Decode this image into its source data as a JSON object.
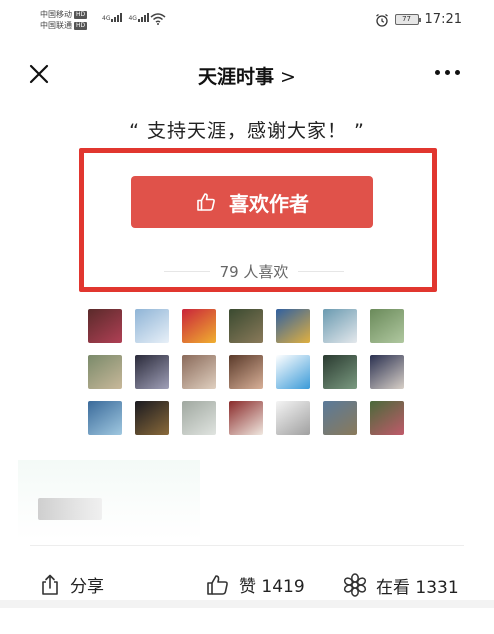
{
  "status_bar": {
    "carrier1": "中国移动",
    "carrier2": "中国联通",
    "hd_label": "HD",
    "network_label_1": "4G",
    "network_label_2": "4G",
    "battery": "77",
    "time": "17:21"
  },
  "nav": {
    "title": "天涯时事"
  },
  "article": {
    "support_text": "“ 支持天涯，感谢大家！ ”",
    "like_author_label": "喜欢作者",
    "like_count_text": "79 人喜欢"
  },
  "avatars": [
    {
      "name": "avatar-1",
      "colors": [
        "#5a2a2a",
        "#b04055"
      ]
    },
    {
      "name": "avatar-2",
      "colors": [
        "#8fb4d6",
        "#e8f0f8"
      ]
    },
    {
      "name": "avatar-3",
      "colors": [
        "#c9243a",
        "#f0b030"
      ]
    },
    {
      "name": "avatar-4",
      "colors": [
        "#3a4a30",
        "#8a7a5a"
      ]
    },
    {
      "name": "avatar-5",
      "colors": [
        "#3060a0",
        "#e0b040"
      ]
    },
    {
      "name": "avatar-6",
      "colors": [
        "#6a9ab0",
        "#e4e8ec"
      ]
    },
    {
      "name": "avatar-7",
      "colors": [
        "#6a8a5a",
        "#b0c8a0"
      ]
    },
    {
      "name": "avatar-8",
      "colors": [
        "#7a8a6a",
        "#c8b89a"
      ]
    },
    {
      "name": "avatar-9",
      "colors": [
        "#2a2a3a",
        "#a0a0b8"
      ]
    },
    {
      "name": "avatar-10",
      "colors": [
        "#8a6a5a",
        "#e0d0c0"
      ]
    },
    {
      "name": "avatar-11",
      "colors": [
        "#5a3a2a",
        "#d8b098"
      ]
    },
    {
      "name": "avatar-12",
      "colors": [
        "#ffffff",
        "#3a9ad8"
      ]
    },
    {
      "name": "avatar-13",
      "colors": [
        "#2a3a30",
        "#7a9a80"
      ]
    },
    {
      "name": "avatar-14",
      "colors": [
        "#2a3050",
        "#d8d0c8"
      ]
    },
    {
      "name": "avatar-15",
      "colors": [
        "#3a6a9a",
        "#a0c8e0"
      ]
    },
    {
      "name": "avatar-16",
      "colors": [
        "#1a1a20",
        "#8a6a3a"
      ]
    },
    {
      "name": "avatar-17",
      "colors": [
        "#a0a8a0",
        "#e0e4e0"
      ]
    },
    {
      "name": "avatar-18",
      "colors": [
        "#8a2a2a",
        "#f0e8e0"
      ]
    },
    {
      "name": "avatar-19",
      "colors": [
        "#f4f4f4",
        "#a0a0a0"
      ]
    },
    {
      "name": "avatar-20",
      "colors": [
        "#5a7a9a",
        "#8a7a5a"
      ]
    },
    {
      "name": "avatar-21",
      "colors": [
        "#4a6a3a",
        "#c05a6a"
      ]
    }
  ],
  "bottom": {
    "share_label": "分享",
    "like_label": "赞 1419",
    "watch_label": "在看 1331"
  },
  "colors": {
    "accent": "#e0524a",
    "highlight_border": "#e1362f"
  }
}
